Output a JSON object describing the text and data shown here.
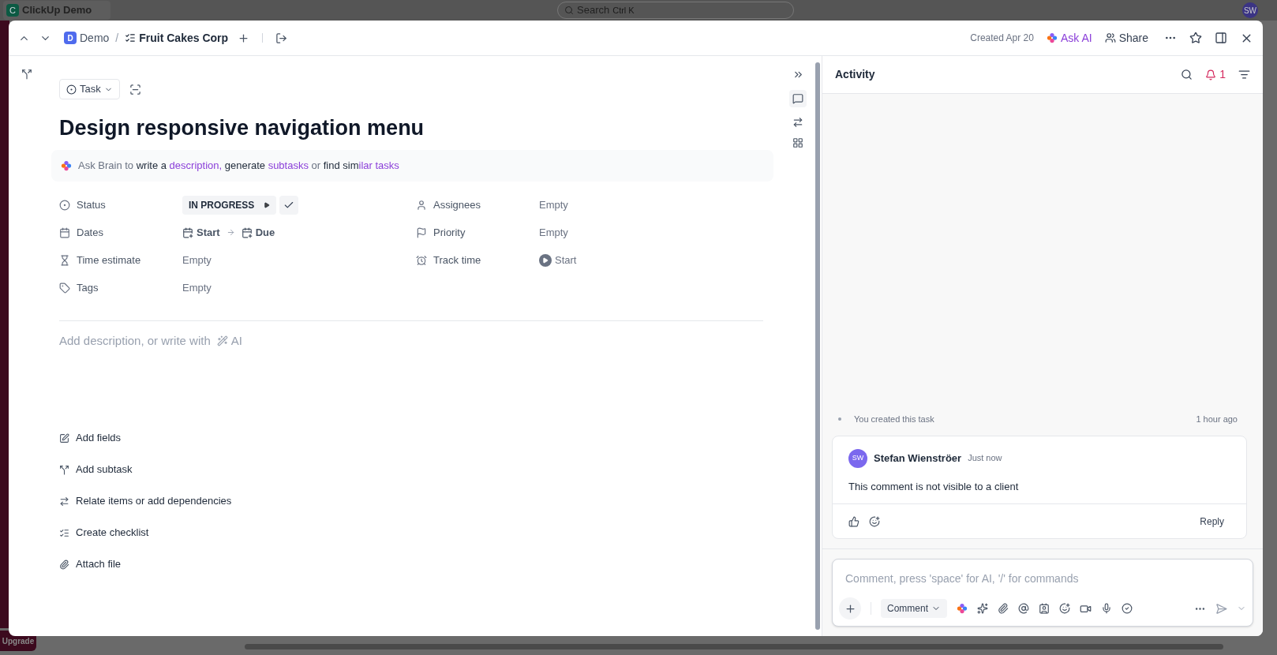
{
  "background": {
    "workspace_badge": "C",
    "workspace": "ClickUp Demo",
    "search": {
      "placeholder": "Search",
      "shortcut": "Ctrl K"
    },
    "avatar": "SW",
    "upgrade": "Upgrade"
  },
  "header": {
    "separator": "/",
    "breadcrumb": [
      {
        "kind": "space",
        "badge": "D",
        "label": "Demo"
      },
      {
        "kind": "list",
        "label": "Fruit Cakes Corp"
      }
    ],
    "created": "Created Apr 20",
    "ask_ai": "Ask AI",
    "share": "Share"
  },
  "task": {
    "type": "Task",
    "title": "Design responsive navigation menu",
    "brain_prompt": [
      {
        "kind": "muted",
        "text": "Ask Brain to "
      },
      {
        "kind": "plain",
        "text": "write a "
      },
      {
        "kind": "accent",
        "text": "description,"
      },
      {
        "kind": "plain",
        "text": " generate "
      },
      {
        "kind": "accent",
        "text": "subtasks"
      },
      {
        "kind": "muted",
        "text": " or "
      },
      {
        "kind": "plain",
        "text": "find sim"
      },
      {
        "kind": "accent",
        "text": "ilar tasks"
      }
    ],
    "fields_left": [
      {
        "kind": "status",
        "label": "Status",
        "value": "IN PROGRESS"
      },
      {
        "kind": "dates",
        "label": "Dates",
        "start": "Start",
        "due": "Due"
      },
      {
        "kind": "text",
        "label": "Time estimate",
        "value": "Empty"
      },
      {
        "kind": "text",
        "label": "Tags",
        "value": "Empty"
      }
    ],
    "fields_right": [
      {
        "kind": "text",
        "label": "Assignees",
        "value": "Empty"
      },
      {
        "kind": "text",
        "label": "Priority",
        "value": "Empty"
      },
      {
        "kind": "timer",
        "label": "Track time",
        "value": "Start"
      }
    ],
    "description_placeholder": "Add description, or write with",
    "ai_label": "AI",
    "actions": [
      "Add fields",
      "Add subtask",
      "Relate items or add dependencies",
      "Create checklist",
      "Attach file"
    ]
  },
  "activity": {
    "title": "Activity",
    "notification_count": "1",
    "events": [
      {
        "text": "You created this task",
        "time": "1 hour ago"
      }
    ],
    "comments": [
      {
        "initials": "SW",
        "color": "#7b68ee",
        "author": "Stefan Wienströer",
        "time": "Just now",
        "body": "This comment is not visible to a client",
        "reply": "Reply"
      }
    ],
    "composer": {
      "placeholder": "Comment, press 'space' for AI, '/' for commands",
      "type": "Comment"
    }
  }
}
